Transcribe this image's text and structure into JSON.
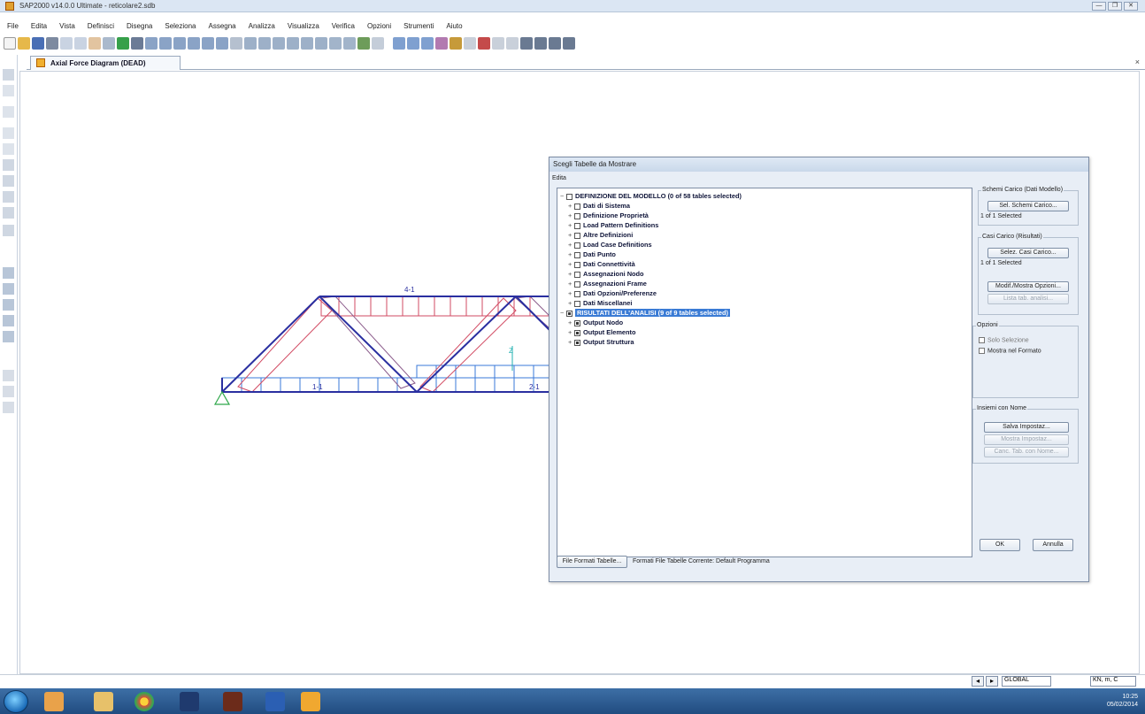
{
  "window": {
    "title": "SAP2000 v14.0.0 Ultimate - reticolare2.sdb",
    "controls": [
      "—",
      "❐",
      "✕"
    ]
  },
  "menu": [
    "File",
    "Edita",
    "Vista",
    "Definisci",
    "Disegna",
    "Seleziona",
    "Assegna",
    "Analizza",
    "Visualizza",
    "Verifica",
    "Opzioni",
    "Strumenti",
    "Aiuto"
  ],
  "tab": {
    "label": "Axial Force Diagram  (DEAD)",
    "close": "×"
  },
  "frame_labels": {
    "top_chord_mid": "4-1",
    "bottom_chord_left": "1-1",
    "bottom_chord_right": "2-1",
    "axis_z": "Z"
  },
  "dialog": {
    "title": "Scegli Tabelle da Mostrare",
    "menu": "Edita",
    "tree": [
      {
        "text": "DEFINIZIONE DEL MODELLO  (0 of 58 tables selected)",
        "level": 0,
        "exp": "−",
        "checked": false,
        "selected": false
      },
      {
        "text": "Dati di Sistema",
        "level": 1,
        "exp": "+",
        "checked": false,
        "selected": false
      },
      {
        "text": "Definizione Proprietà",
        "level": 1,
        "exp": "+",
        "checked": false,
        "selected": false
      },
      {
        "text": "Load Pattern Definitions",
        "level": 1,
        "exp": "+",
        "checked": false,
        "selected": false
      },
      {
        "text": "Altre Definizioni",
        "level": 1,
        "exp": "+",
        "checked": false,
        "selected": false
      },
      {
        "text": "Load Case Definitions",
        "level": 1,
        "exp": "+",
        "checked": false,
        "selected": false
      },
      {
        "text": "Dati Punto",
        "level": 1,
        "exp": "+",
        "checked": false,
        "selected": false
      },
      {
        "text": "Dati Connettività",
        "level": 1,
        "exp": "+",
        "checked": false,
        "selected": false
      },
      {
        "text": "Assegnazioni Nodo",
        "level": 1,
        "exp": "+",
        "checked": false,
        "selected": false
      },
      {
        "text": "Assegnazioni Frame",
        "level": 1,
        "exp": "+",
        "checked": false,
        "selected": false
      },
      {
        "text": "Dati Opzioni/Preferenze",
        "level": 1,
        "exp": "+",
        "checked": false,
        "selected": false
      },
      {
        "text": "Dati Miscellanei",
        "level": 1,
        "exp": "+",
        "checked": false,
        "selected": false
      },
      {
        "text": "RISULTATI DELL'ANALISI  (9 of 9 tables selected)",
        "level": 0,
        "exp": "−",
        "checked": true,
        "selected": true
      },
      {
        "text": "Output Nodo",
        "level": 1,
        "exp": "+",
        "checked": true,
        "selected": false
      },
      {
        "text": "Output Elemento",
        "level": 1,
        "exp": "+",
        "checked": true,
        "selected": false
      },
      {
        "text": "Output Struttura",
        "level": 1,
        "exp": "+",
        "checked": true,
        "selected": false
      }
    ],
    "load_patterns": {
      "group_title": "Schemi Carico (Dati Modello)",
      "button": "Sel. Schemi Carico...",
      "count": "1 of 1 Selected"
    },
    "load_cases": {
      "group_title": "Casi Carico (Risultati)",
      "button": "Selez. Casi Carico...",
      "count": "1 of 1 Selected",
      "modify_button": "Modif./Mostra Opzioni...",
      "disabled_button": "Lista tab. analisi..."
    },
    "options": {
      "group_title": "Opzioni",
      "checks": [
        "Solo Selezione",
        "Mostra nel Formato"
      ]
    },
    "named_sets": {
      "group_title": "Insiemi con Nome",
      "buttons": [
        "Salva Impostaz...",
        "Mostra Impostaz...",
        "Canc. Tab. con Nome..."
      ]
    },
    "ok": "OK",
    "cancel": "Annulla",
    "format_button": "File Formati Tabelle...",
    "format_text": "Formati File Tabelle Corrente: Default Programma"
  },
  "status": {
    "coord": "GLOBAL",
    "units": "KN, m, C"
  },
  "taskbar": {
    "clock_time": "10:25",
    "clock_date": "05/02/2014"
  },
  "colors": {
    "frame": "#2a2fa0",
    "compression": "#d24b63",
    "tension": "#3a78d8",
    "support": "#2fa84a"
  }
}
